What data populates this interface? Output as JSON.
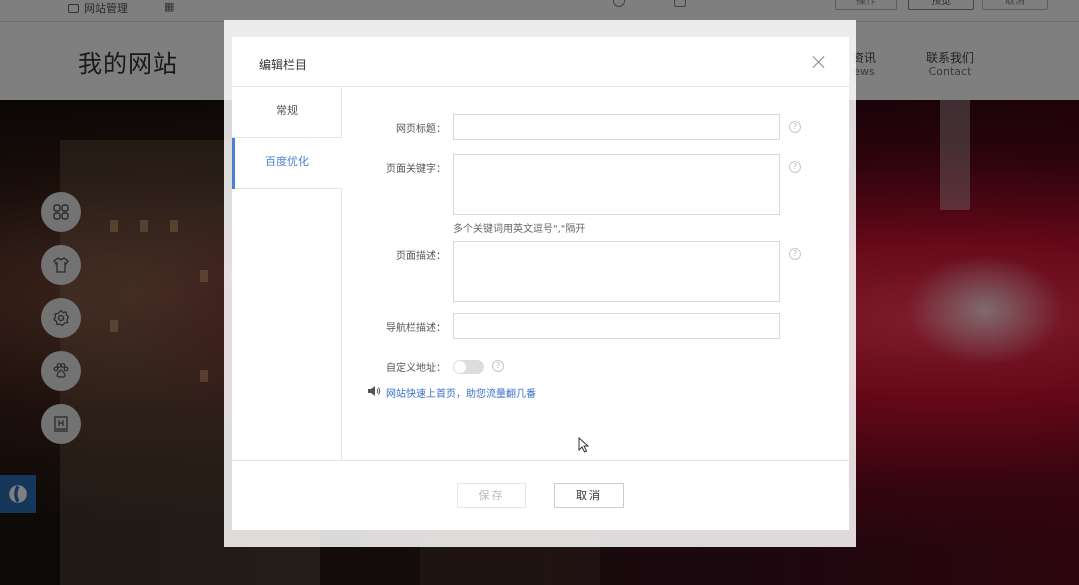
{
  "toolbar": {
    "left_label": "网站管理",
    "grid_icon": "grid-icon",
    "btn_a": "操作",
    "btn_b": "预览",
    "btn_c": "取消"
  },
  "site": {
    "logo": "我的网站",
    "nav": [
      {
        "cn": "资讯",
        "en": "ews"
      },
      {
        "cn": "联系我们",
        "en": "Contact"
      }
    ]
  },
  "side_tools": [
    "apps-icon",
    "shirt-icon",
    "gear-icon",
    "paw-icon",
    "book-icon"
  ],
  "modal": {
    "title": "编辑栏目",
    "tabs": [
      {
        "label": "常规",
        "active": false
      },
      {
        "label": "百度优化",
        "active": true
      }
    ],
    "fields": {
      "page_title": {
        "label": "网页标题：",
        "value": ""
      },
      "keywords": {
        "label": "页面关键字：",
        "value": "",
        "hint": "多个关键词用英文逗号\",\"隔开"
      },
      "description": {
        "label": "页面描述：",
        "value": ""
      },
      "nav_description": {
        "label": "导航栏描述：",
        "value": ""
      },
      "custom_url": {
        "label": "自定义地址：",
        "enabled": false
      }
    },
    "help_glyph": "?",
    "promo_text": "网站快速上首页，助您流量翻几番",
    "buttons": {
      "save": "保存",
      "cancel": "取消"
    }
  },
  "colors": {
    "accent": "#4a7fd6",
    "link": "#3a6fc8",
    "overlay": "rgba(0,0,0,0.5)"
  }
}
